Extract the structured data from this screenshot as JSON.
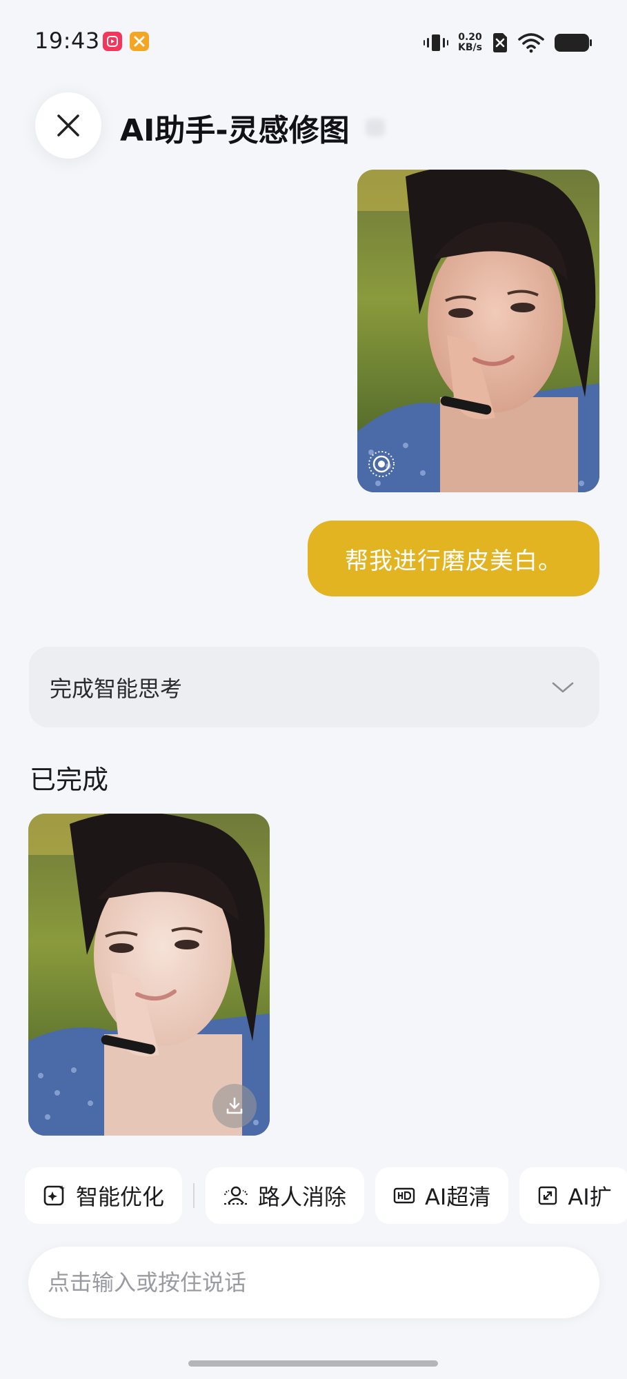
{
  "status_bar": {
    "time": "19:43",
    "net_speed_value": "0.20",
    "net_speed_unit": "KB/s",
    "icons": [
      "video-app-icon",
      "tools-app-icon",
      "vibrate-icon",
      "no-sim-icon",
      "wifi-icon",
      "battery-icon"
    ]
  },
  "header": {
    "title": "AI助手-灵感修图",
    "close_icon": "close-icon"
  },
  "chat": {
    "user_message": "帮我进行磨皮美白。",
    "thinking_label": "完成智能思考",
    "status_label": "已完成"
  },
  "actions": [
    {
      "label": "智能优化",
      "icon": "smart-enhance-icon"
    },
    {
      "label": "路人消除",
      "icon": "remove-people-icon"
    },
    {
      "label": "AI超清",
      "icon": "hd-icon"
    },
    {
      "label": "AI扩",
      "icon": "expand-icon"
    }
  ],
  "input": {
    "placeholder": "点击输入或按住说话"
  },
  "colors": {
    "bubble": "#e2b422",
    "background": "#f5f6fa"
  }
}
